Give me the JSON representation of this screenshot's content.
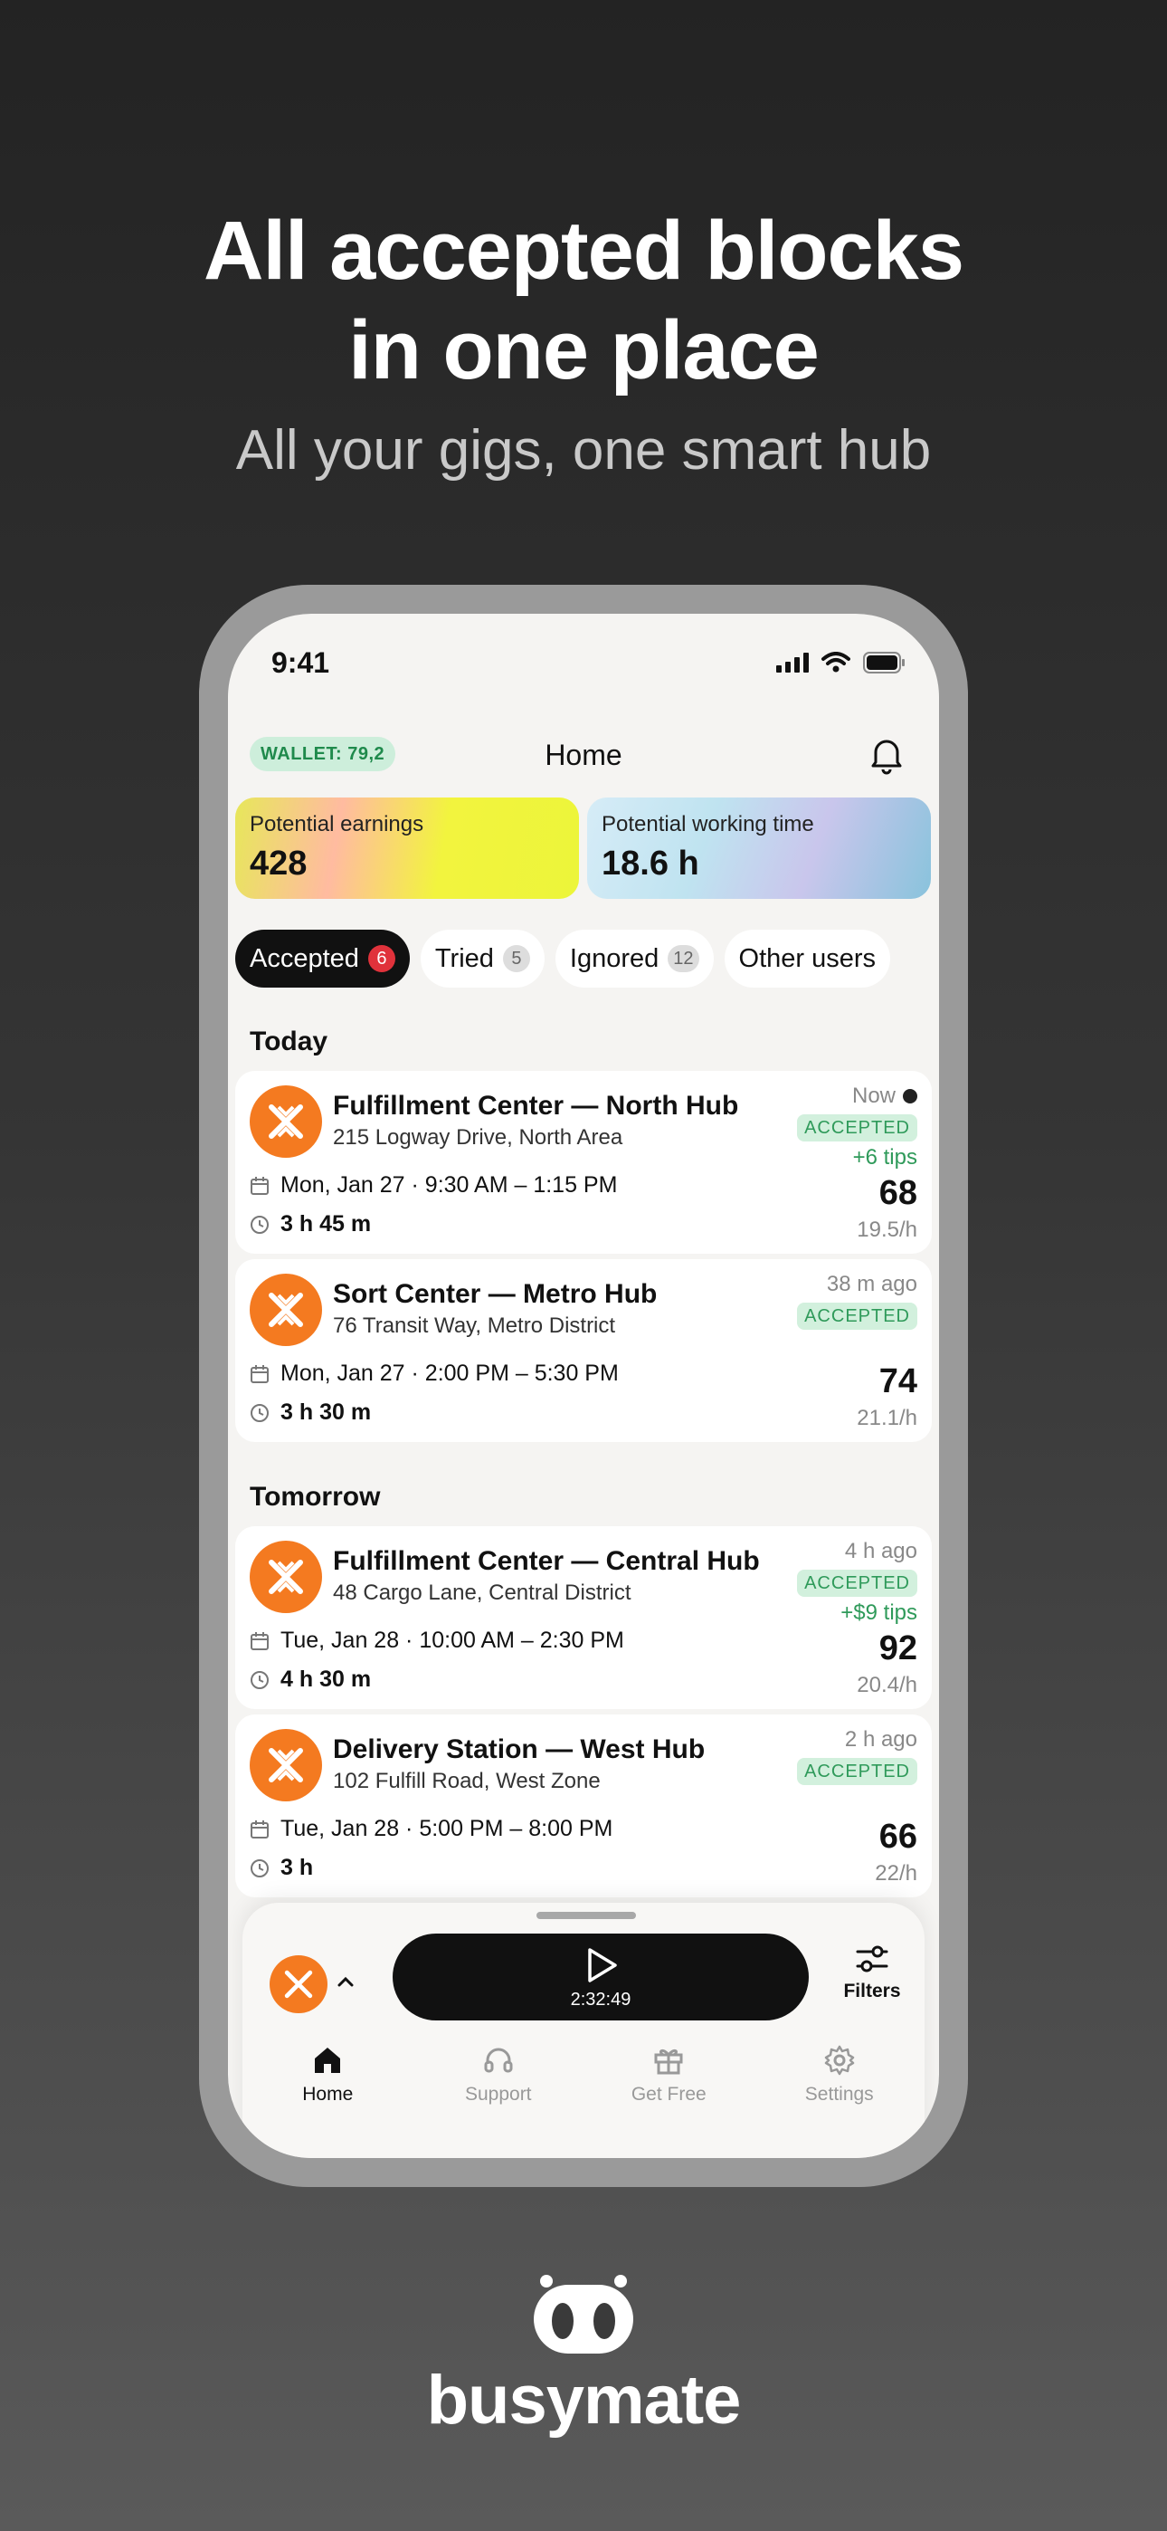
{
  "marketing": {
    "headline_line1": "All accepted blocks",
    "headline_line2": "in one place",
    "subheadline": "All your gigs, one smart hub",
    "brand": "busymate"
  },
  "status_bar": {
    "time": "9:41"
  },
  "header": {
    "wallet": "WALLET: 79,2",
    "title": "Home"
  },
  "stats": [
    {
      "label": "Potential earnings",
      "value": "428"
    },
    {
      "label": "Potential working time",
      "value": "18.6 h"
    }
  ],
  "tabs": [
    {
      "label": "Accepted",
      "count": "6"
    },
    {
      "label": "Tried",
      "count": "5"
    },
    {
      "label": "Ignored",
      "count": "12"
    },
    {
      "label": "Other users"
    }
  ],
  "sections": {
    "today": "Today",
    "tomorrow": "Tomorrow"
  },
  "cards": [
    {
      "name": "Fulfillment Center — North Hub",
      "address": "215 Logway Drive, North Area",
      "date": "Mon, Jan 27 · 9:30 AM – 1:15 PM",
      "duration": "3 h 45 m",
      "ago": "Now",
      "status": "ACCEPTED",
      "tips": "+6 tips",
      "amount": "68",
      "rate": "19.5/h"
    },
    {
      "name": "Sort Center — Metro Hub",
      "address": "76 Transit Way, Metro District",
      "date": "Mon, Jan 27 · 2:00 PM – 5:30 PM",
      "duration": "3 h 30 m",
      "ago": "38 m ago",
      "status": "ACCEPTED",
      "amount": "74",
      "rate": "21.1/h"
    },
    {
      "name": "Fulfillment Center — Central Hub",
      "address": "48 Cargo Lane, Central District",
      "date": "Tue, Jan 28 · 10:00 AM – 2:30 PM",
      "duration": "4 h 30 m",
      "ago": "4 h ago",
      "status": "ACCEPTED",
      "tips": "+$9 tips",
      "amount": "92",
      "rate": "20.4/h"
    },
    {
      "name": "Delivery Station — West Hub",
      "address": "102 Fulfill Road, West Zone",
      "date": "Tue, Jan 28 · 5:00 PM – 8:00 PM",
      "duration": "3 h",
      "ago": "2 h ago",
      "status": "ACCEPTED",
      "amount": "66",
      "rate": "22/h"
    }
  ],
  "player": {
    "time": "2:32:49",
    "filters": "Filters"
  },
  "nav": [
    {
      "label": "Home",
      "icon": "home-icon"
    },
    {
      "label": "Support",
      "icon": "headset-icon"
    },
    {
      "label": "Get Free",
      "icon": "gift-icon"
    },
    {
      "label": "Settings",
      "icon": "gear-icon"
    }
  ],
  "colors": {
    "accent_orange": "#f47a20",
    "accepted_green": "#2f9a5a",
    "badge_red": "#e0323b"
  }
}
